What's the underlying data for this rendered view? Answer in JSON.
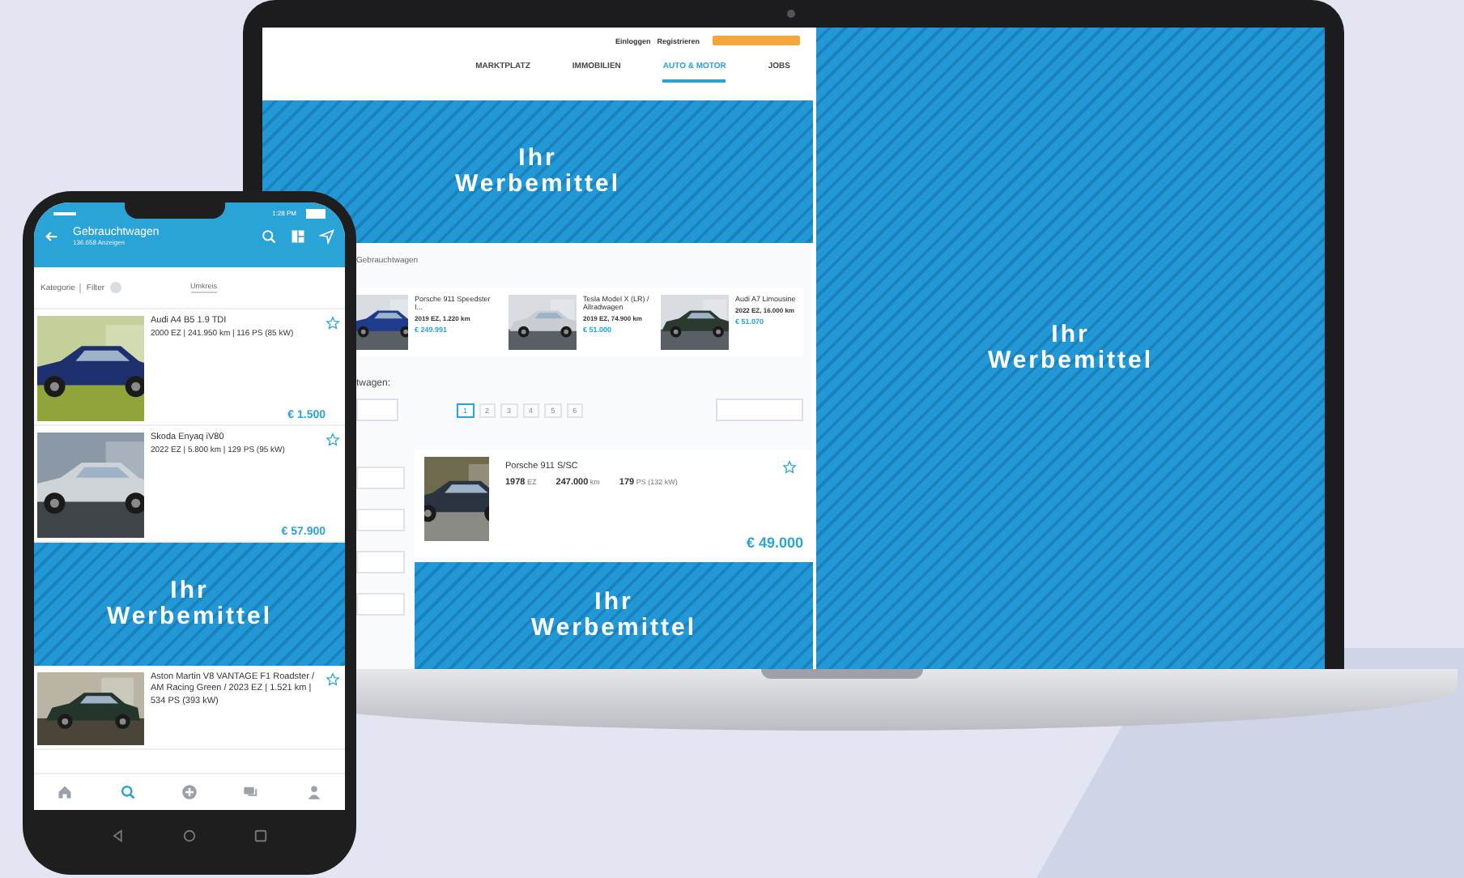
{
  "laptop": {
    "top_links": [
      {
        "label": "Einloggen"
      },
      {
        "label": "Registrieren"
      }
    ],
    "nav_tabs": [
      {
        "label": "MARKTPLATZ",
        "selected": false
      },
      {
        "label": "IMMOBILIEN",
        "selected": false
      },
      {
        "label": "AUTO & MOTOR",
        "selected": true
      },
      {
        "label": "JOBS",
        "selected": false
      }
    ],
    "top_ad": "Ihr Werbemittel",
    "side_ad": "Ihr Werbemittel",
    "breadcrumb": "Gebrauchtwagen",
    "featured": [
      {
        "title": "Porsche 911 Speedster I...",
        "details": "2019 EZ, 1.220 km",
        "price": "€ 249.991"
      },
      {
        "title": "Tesla Model X (LR) / Allradwagen",
        "details": "2019 EZ, 74.900 km",
        "price": "€ 51.000"
      },
      {
        "title": "Audi A7 Limousine",
        "details": "2022 EZ, 16.000 km",
        "price": "€ 51.070"
      }
    ],
    "section_heading": "twagen:",
    "pages": [
      {
        "label": "1",
        "selected": true
      },
      {
        "label": "2",
        "selected": false
      },
      {
        "label": "3",
        "selected": false
      },
      {
        "label": "4",
        "selected": false
      },
      {
        "label": "5",
        "selected": false
      },
      {
        "label": "6",
        "selected": false
      }
    ],
    "listing": {
      "title": "Porsche 911 S/SC",
      "favorite": false,
      "specs": [
        {
          "value": "1978",
          "unit": "EZ"
        },
        {
          "value": "247.000",
          "unit": "km"
        },
        {
          "value": "179",
          "unit": "PS (132 kW)"
        }
      ],
      "price": "€ 49.000"
    },
    "bottom_ad": "Ihr Werbemittel"
  },
  "phone": {
    "time": "1:28 PM",
    "title": "Gebrauchtwagen",
    "subtitle": "136.658 Anzeigen",
    "filters": [
      "Kategorie",
      "Filter"
    ],
    "sort": "Umkreis",
    "listings": [
      {
        "title": "Audi A4 B5 1.9 TDI",
        "details": "2000 EZ | 241.950 km | 116 PS (85 kW)",
        "price": "€ 1.500",
        "favorite": false
      },
      {
        "title": "Skoda Enyaq iV80",
        "details": "2022 EZ | 5.800 km | 129 PS (95 kW)",
        "price": "€ 57.900",
        "favorite": false
      }
    ],
    "ad": "Ihr Werbemittel",
    "last_listing": {
      "text": "Aston Martin V8 VANTAGE F1 Roadster / AM Racing Green / 2023 EZ | 1.521 km | 534 PS (393 kW)",
      "favorite": false
    },
    "nav_items": [
      {
        "kind": "home",
        "selected": false
      },
      {
        "kind": "search",
        "selected": true
      },
      {
        "kind": "add",
        "selected": false
      },
      {
        "kind": "messages",
        "selected": false
      },
      {
        "kind": "profile",
        "selected": false
      }
    ]
  }
}
